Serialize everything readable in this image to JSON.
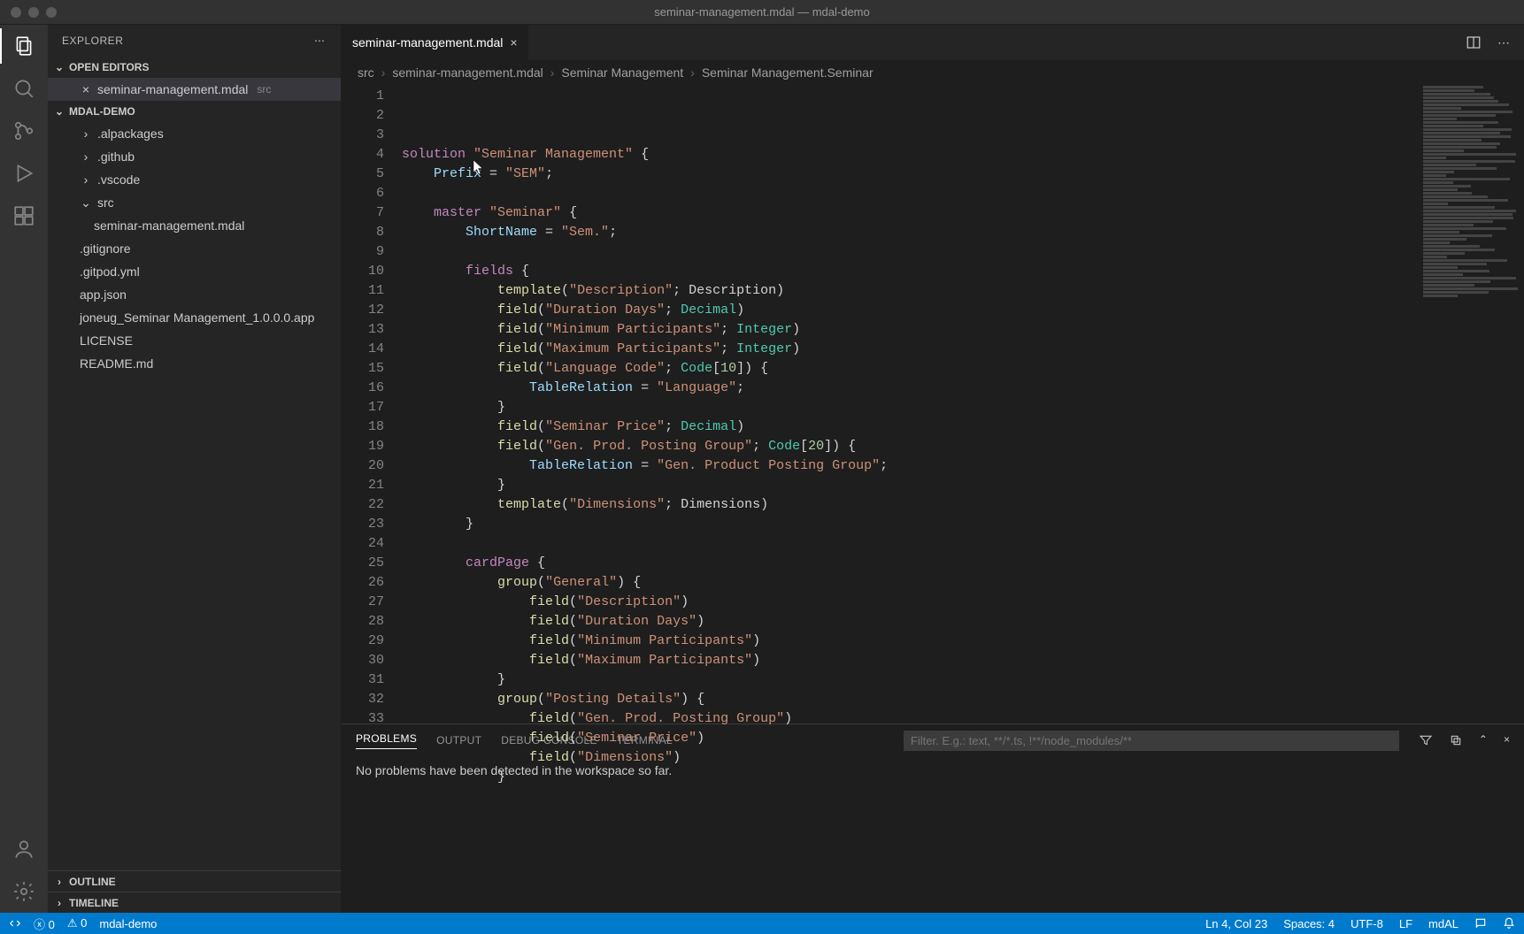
{
  "window": {
    "title": "seminar-management.mdal — mdal-demo"
  },
  "sidebar": {
    "title": "EXPLORER",
    "openEditors": {
      "label": "OPEN EDITORS"
    },
    "openEditor": {
      "name": "seminar-management.mdal",
      "desc": "src"
    },
    "workspace": {
      "label": "MDAL-DEMO"
    },
    "tree": [
      {
        "name": ".alpackages",
        "kind": "folder",
        "indent": 1
      },
      {
        "name": ".github",
        "kind": "folder",
        "indent": 1
      },
      {
        "name": ".vscode",
        "kind": "folder",
        "indent": 1
      },
      {
        "name": "src",
        "kind": "folder-open",
        "indent": 1
      },
      {
        "name": "seminar-management.mdal",
        "kind": "file",
        "indent": 2
      },
      {
        "name": ".gitignore",
        "kind": "file",
        "indent": 1
      },
      {
        "name": ".gitpod.yml",
        "kind": "file",
        "indent": 1
      },
      {
        "name": "app.json",
        "kind": "file",
        "indent": 1
      },
      {
        "name": "joneug_Seminar Management_1.0.0.0.app",
        "kind": "file",
        "indent": 1
      },
      {
        "name": "LICENSE",
        "kind": "file",
        "indent": 1
      },
      {
        "name": "README.md",
        "kind": "file",
        "indent": 1
      }
    ],
    "outline": "OUTLINE",
    "timeline": "TIMELINE"
  },
  "tab": {
    "name": "seminar-management.mdal"
  },
  "breadcrumb": {
    "p1": "src",
    "p2": "seminar-management.mdal",
    "p3": "Seminar Management",
    "p4": "Seminar Management.Seminar"
  },
  "code": {
    "lines": [
      [
        [
          "kw",
          "solution"
        ],
        [
          "txt",
          " "
        ],
        [
          "str",
          "\"Seminar Management\""
        ],
        [
          "txt",
          " {"
        ]
      ],
      [
        [
          "txt",
          "    "
        ],
        [
          "id",
          "Prefix"
        ],
        [
          "txt",
          " = "
        ],
        [
          "str",
          "\"SEM\""
        ],
        [
          "txt",
          ";"
        ]
      ],
      [
        [
          "txt",
          ""
        ]
      ],
      [
        [
          "txt",
          "    "
        ],
        [
          "kw",
          "master"
        ],
        [
          "txt",
          " "
        ],
        [
          "str",
          "\"Seminar\""
        ],
        [
          "txt",
          " {"
        ]
      ],
      [
        [
          "txt",
          "        "
        ],
        [
          "id",
          "ShortName"
        ],
        [
          "txt",
          " = "
        ],
        [
          "str",
          "\"Sem.\""
        ],
        [
          "txt",
          ";"
        ]
      ],
      [
        [
          "txt",
          ""
        ]
      ],
      [
        [
          "txt",
          "        "
        ],
        [
          "kw",
          "fields"
        ],
        [
          "txt",
          " {"
        ]
      ],
      [
        [
          "txt",
          "            "
        ],
        [
          "fn",
          "template"
        ],
        [
          "txt",
          "("
        ],
        [
          "str",
          "\"Description\""
        ],
        [
          "txt",
          "; Description)"
        ]
      ],
      [
        [
          "txt",
          "            "
        ],
        [
          "fn",
          "field"
        ],
        [
          "txt",
          "("
        ],
        [
          "str",
          "\"Duration Days\""
        ],
        [
          "txt",
          "; "
        ],
        [
          "type",
          "Decimal"
        ],
        [
          "txt",
          ")"
        ]
      ],
      [
        [
          "txt",
          "            "
        ],
        [
          "fn",
          "field"
        ],
        [
          "txt",
          "("
        ],
        [
          "str",
          "\"Minimum Participants\""
        ],
        [
          "txt",
          "; "
        ],
        [
          "type",
          "Integer"
        ],
        [
          "txt",
          ")"
        ]
      ],
      [
        [
          "txt",
          "            "
        ],
        [
          "fn",
          "field"
        ],
        [
          "txt",
          "("
        ],
        [
          "str",
          "\"Maximum Participants\""
        ],
        [
          "txt",
          "; "
        ],
        [
          "type",
          "Integer"
        ],
        [
          "txt",
          ")"
        ]
      ],
      [
        [
          "txt",
          "            "
        ],
        [
          "fn",
          "field"
        ],
        [
          "txt",
          "("
        ],
        [
          "str",
          "\"Language Code\""
        ],
        [
          "txt",
          "; "
        ],
        [
          "type",
          "Code"
        ],
        [
          "txt",
          "["
        ],
        [
          "num",
          "10"
        ],
        [
          "txt",
          "]) {"
        ]
      ],
      [
        [
          "txt",
          "                "
        ],
        [
          "id",
          "TableRelation"
        ],
        [
          "txt",
          " = "
        ],
        [
          "str",
          "\"Language\""
        ],
        [
          "txt",
          ";"
        ]
      ],
      [
        [
          "txt",
          "            }"
        ]
      ],
      [
        [
          "txt",
          "            "
        ],
        [
          "fn",
          "field"
        ],
        [
          "txt",
          "("
        ],
        [
          "str",
          "\"Seminar Price\""
        ],
        [
          "txt",
          "; "
        ],
        [
          "type",
          "Decimal"
        ],
        [
          "txt",
          ")"
        ]
      ],
      [
        [
          "txt",
          "            "
        ],
        [
          "fn",
          "field"
        ],
        [
          "txt",
          "("
        ],
        [
          "str",
          "\"Gen. Prod. Posting Group\""
        ],
        [
          "txt",
          "; "
        ],
        [
          "type",
          "Code"
        ],
        [
          "txt",
          "["
        ],
        [
          "num",
          "20"
        ],
        [
          "txt",
          "]) {"
        ]
      ],
      [
        [
          "txt",
          "                "
        ],
        [
          "id",
          "TableRelation"
        ],
        [
          "txt",
          " = "
        ],
        [
          "str",
          "\"Gen. Product Posting Group\""
        ],
        [
          "txt",
          ";"
        ]
      ],
      [
        [
          "txt",
          "            }"
        ]
      ],
      [
        [
          "txt",
          "            "
        ],
        [
          "fn",
          "template"
        ],
        [
          "txt",
          "("
        ],
        [
          "str",
          "\"Dimensions\""
        ],
        [
          "txt",
          "; Dimensions)"
        ]
      ],
      [
        [
          "txt",
          "        }"
        ]
      ],
      [
        [
          "txt",
          ""
        ]
      ],
      [
        [
          "txt",
          "        "
        ],
        [
          "kw",
          "cardPage"
        ],
        [
          "txt",
          " {"
        ]
      ],
      [
        [
          "txt",
          "            "
        ],
        [
          "fn",
          "group"
        ],
        [
          "txt",
          "("
        ],
        [
          "str",
          "\"General\""
        ],
        [
          "txt",
          ") {"
        ]
      ],
      [
        [
          "txt",
          "                "
        ],
        [
          "fn",
          "field"
        ],
        [
          "txt",
          "("
        ],
        [
          "str",
          "\"Description\""
        ],
        [
          "txt",
          ")"
        ]
      ],
      [
        [
          "txt",
          "                "
        ],
        [
          "fn",
          "field"
        ],
        [
          "txt",
          "("
        ],
        [
          "str",
          "\"Duration Days\""
        ],
        [
          "txt",
          ")"
        ]
      ],
      [
        [
          "txt",
          "                "
        ],
        [
          "fn",
          "field"
        ],
        [
          "txt",
          "("
        ],
        [
          "str",
          "\"Minimum Participants\""
        ],
        [
          "txt",
          ")"
        ]
      ],
      [
        [
          "txt",
          "                "
        ],
        [
          "fn",
          "field"
        ],
        [
          "txt",
          "("
        ],
        [
          "str",
          "\"Maximum Participants\""
        ],
        [
          "txt",
          ")"
        ]
      ],
      [
        [
          "txt",
          "            }"
        ]
      ],
      [
        [
          "txt",
          "            "
        ],
        [
          "fn",
          "group"
        ],
        [
          "txt",
          "("
        ],
        [
          "str",
          "\"Posting Details\""
        ],
        [
          "txt",
          ") {"
        ]
      ],
      [
        [
          "txt",
          "                "
        ],
        [
          "fn",
          "field"
        ],
        [
          "txt",
          "("
        ],
        [
          "str",
          "\"Gen. Prod. Posting Group\""
        ],
        [
          "txt",
          ")"
        ]
      ],
      [
        [
          "txt",
          "                "
        ],
        [
          "fn",
          "field"
        ],
        [
          "txt",
          "("
        ],
        [
          "str",
          "\"Seminar Price\""
        ],
        [
          "txt",
          ")"
        ]
      ],
      [
        [
          "txt",
          "                "
        ],
        [
          "fn",
          "field"
        ],
        [
          "txt",
          "("
        ],
        [
          "str",
          "\"Dimensions\""
        ],
        [
          "txt",
          ")"
        ]
      ],
      [
        [
          "txt",
          "            }"
        ]
      ]
    ]
  },
  "panel": {
    "tabs": {
      "problems": "PROBLEMS",
      "output": "OUTPUT",
      "debug": "DEBUG CONSOLE",
      "terminal": "TERMINAL"
    },
    "filterPlaceholder": "Filter. E.g.: text, **/*.ts, !**/node_modules/**",
    "message": "No problems have been detected in the workspace so far."
  },
  "status": {
    "errors": "0",
    "warnings": "0",
    "branch": "mdal-demo",
    "pos": "Ln 4, Col 23",
    "spaces": "Spaces: 4",
    "enc": "UTF-8",
    "eol": "LF",
    "lang": "mdAL"
  }
}
